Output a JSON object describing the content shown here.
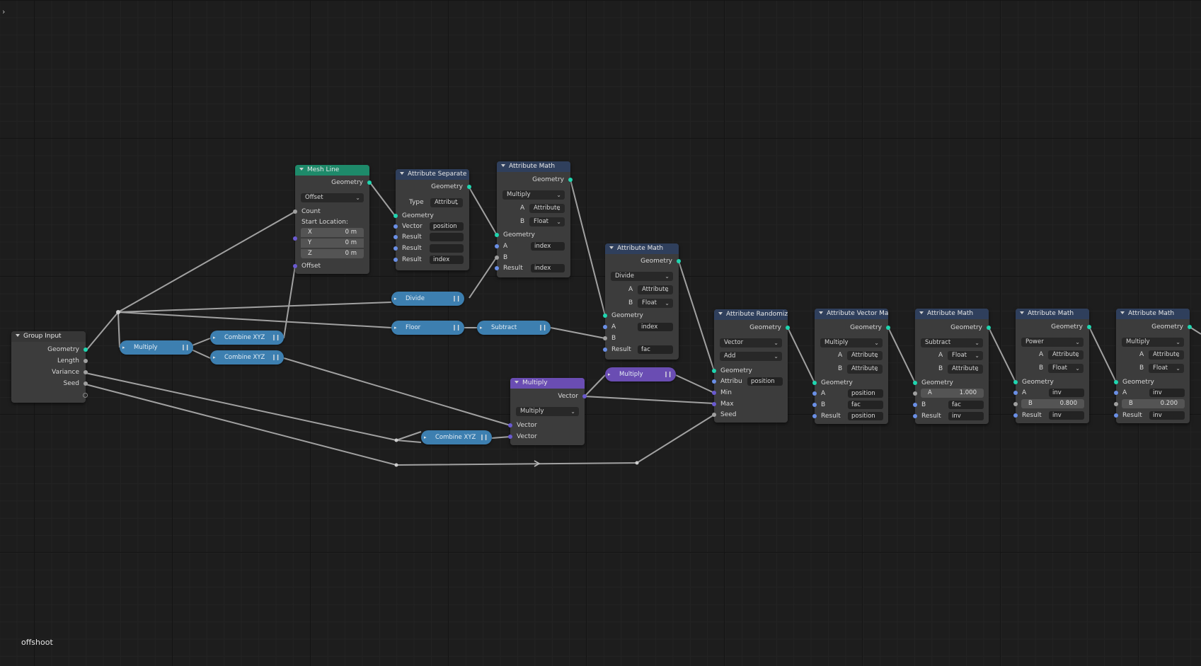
{
  "tree_name": "offshoot",
  "sidebar_toggle_glyph": "›",
  "colors": {
    "geometry_socket": "#1fd6b0",
    "float_socket": "#6a8fe6",
    "vector_socket": "#6a5ad0",
    "attribute_header": "#2f3f5c",
    "mesh_header": "#1e8a6a",
    "vector_header": "#6a4db3",
    "reroute_node": "#3d7fb0"
  },
  "group_input": {
    "title": "Group Input",
    "outputs": [
      "Geometry",
      "Length",
      "Variance",
      "Seed"
    ]
  },
  "mesh_line": {
    "title": "Mesh Line",
    "out": "Geometry",
    "mode": "Offset",
    "count": "Count",
    "start_label": "Start Location:",
    "x_label": "X",
    "x_val": "0 m",
    "y_label": "Y",
    "y_val": "0 m",
    "z_label": "Z",
    "z_val": "0 m",
    "offset": "Offset"
  },
  "attr_separate": {
    "title": "Attribute Separate ...",
    "out": "Geometry",
    "type_label": "Type",
    "type_val": "Attribut",
    "in_geom": "Geometry",
    "vector_label": "Vector",
    "vector_val": "position",
    "result1": "Result",
    "result2": "Result",
    "result3": "Result",
    "result3_val": "index"
  },
  "attr_math1": {
    "title": "Attribute Math",
    "out": "Geometry",
    "op": "Multiply",
    "a_label": "A",
    "a_type": "Attribute",
    "b_label": "B",
    "b_type": "Float",
    "in_geom": "Geometry",
    "a_in": "A",
    "a_val": "index",
    "b_in": "B",
    "result": "Result",
    "result_val": "index"
  },
  "attr_math2": {
    "title": "Attribute Math",
    "out": "Geometry",
    "op": "Divide",
    "a_label": "A",
    "a_type": "Attribute",
    "b_label": "B",
    "b_type": "Float",
    "in_geom": "Geometry",
    "a_in": "A",
    "a_val": "index",
    "b_in": "B",
    "result": "Result",
    "result_val": "fac"
  },
  "attr_randomize": {
    "title": "Attribute Randomize",
    "out": "Geometry",
    "type": "Vector",
    "op": "Add",
    "in_geom": "Geometry",
    "attr_label": "Attribu",
    "attr_val": "position",
    "min": "Min",
    "max": "Max",
    "seed": "Seed"
  },
  "attr_vec_math": {
    "title": "Attribute Vector Math",
    "out": "Geometry",
    "op": "Multiply",
    "a_label": "A",
    "a_type": "Attribute",
    "b_label": "B",
    "b_type": "Attribute",
    "in_geom": "Geometry",
    "a_in": "A",
    "a_val": "position",
    "b_in": "B",
    "b_val": "fac",
    "result": "Result",
    "result_val": "position"
  },
  "attr_math3": {
    "title": "Attribute Math",
    "out": "Geometry",
    "op": "Subtract",
    "a_label": "A",
    "a_type": "Float",
    "b_label": "B",
    "b_type": "Attribute",
    "in_geom": "Geometry",
    "a_in": "A",
    "a_val": "1.000",
    "b_in": "B",
    "b_val": "fac",
    "result": "Result",
    "result_val": "inv"
  },
  "attr_math4": {
    "title": "Attribute Math",
    "out": "Geometry",
    "op": "Power",
    "a_label": "A",
    "a_type": "Attribute",
    "b_label": "B",
    "b_type": "Float",
    "in_geom": "Geometry",
    "a_in": "A",
    "a_val": "inv",
    "b_in": "B",
    "b_val": "0.800",
    "result": "Result",
    "result_val": "inv"
  },
  "attr_math5": {
    "title": "Attribute Math",
    "out": "Geometry",
    "op": "Multiply",
    "a_label": "A",
    "a_type": "Attribute",
    "b_label": "B",
    "b_type": "Float",
    "in_geom": "Geometry",
    "a_in": "A",
    "a_val": "inv",
    "b_in": "B",
    "b_val": "0.200",
    "result": "Result",
    "result_val": "inv"
  },
  "vec_multiply": {
    "title": "Multiply",
    "out": "Vector",
    "op": "Multiply",
    "in1": "Vector",
    "in2": "Vector"
  },
  "collapsed": {
    "divide": "Divide",
    "floor": "Floor",
    "subtract": "Subtract",
    "multiply1": "Multiply",
    "combine1": "Combine XYZ",
    "combine2": "Combine XYZ",
    "combine3": "Combine XYZ",
    "multiply2": "Multiply"
  }
}
